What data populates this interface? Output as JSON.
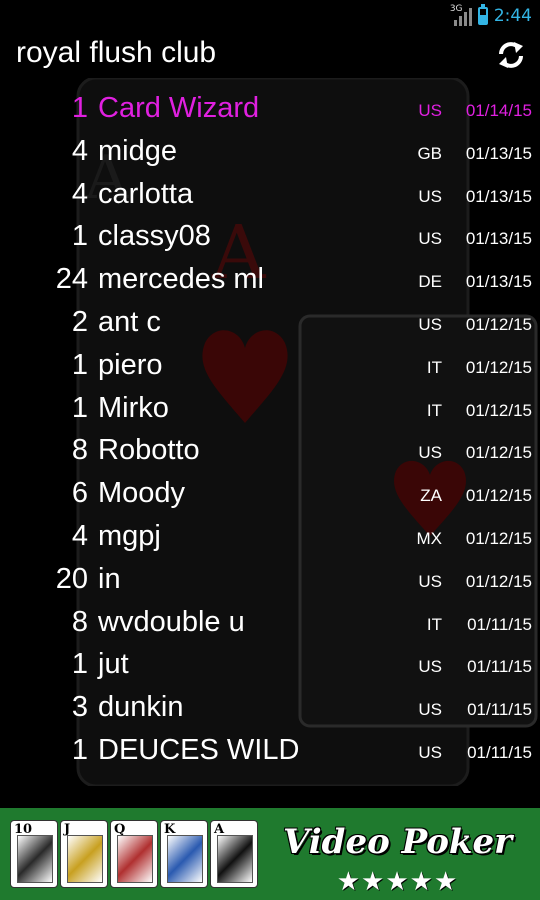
{
  "status_bar": {
    "network_label": "3G",
    "time": "2:44",
    "battery_level": 0.6
  },
  "action_bar": {
    "title": "royal flush club",
    "refresh_icon": "refresh-icon"
  },
  "highlight_color": "#e020e0",
  "accent_color": "#33b5e5",
  "rows": [
    {
      "count": "1",
      "name": "Card Wizard",
      "country": "US",
      "date": "01/14/15"
    },
    {
      "count": "4",
      "name": "midge",
      "country": "GB",
      "date": "01/13/15"
    },
    {
      "count": "4",
      "name": "carlotta",
      "country": "US",
      "date": "01/13/15"
    },
    {
      "count": "1",
      "name": "classy08",
      "country": "US",
      "date": "01/13/15"
    },
    {
      "count": "24",
      "name": "mercedes ml",
      "country": "DE",
      "date": "01/13/15"
    },
    {
      "count": "2",
      "name": "ant c",
      "country": "US",
      "date": "01/12/15"
    },
    {
      "count": "1",
      "name": "piero",
      "country": "IT",
      "date": "01/12/15"
    },
    {
      "count": "1",
      "name": "Mirko",
      "country": "IT",
      "date": "01/12/15"
    },
    {
      "count": "8",
      "name": "Robotto",
      "country": "US",
      "date": "01/12/15"
    },
    {
      "count": "6",
      "name": "Moody",
      "country": "ZA",
      "date": "01/12/15"
    },
    {
      "count": "4",
      "name": "mgpj",
      "country": "MX",
      "date": "01/12/15"
    },
    {
      "count": "20",
      "name": "in",
      "country": "US",
      "date": "01/12/15"
    },
    {
      "count": "8",
      "name": "wvdouble u",
      "country": "IT",
      "date": "01/11/15"
    },
    {
      "count": "1",
      "name": "jut",
      "country": "US",
      "date": "01/11/15"
    },
    {
      "count": "3",
      "name": "dunkin",
      "country": "US",
      "date": "01/11/15"
    },
    {
      "count": "1",
      "name": "DEUCES WILD",
      "country": "US",
      "date": "01/11/15"
    }
  ],
  "banner": {
    "cards": [
      "10",
      "J",
      "Q",
      "K",
      "A"
    ],
    "logo_text": "Video Poker",
    "stars": "★★★★★"
  }
}
